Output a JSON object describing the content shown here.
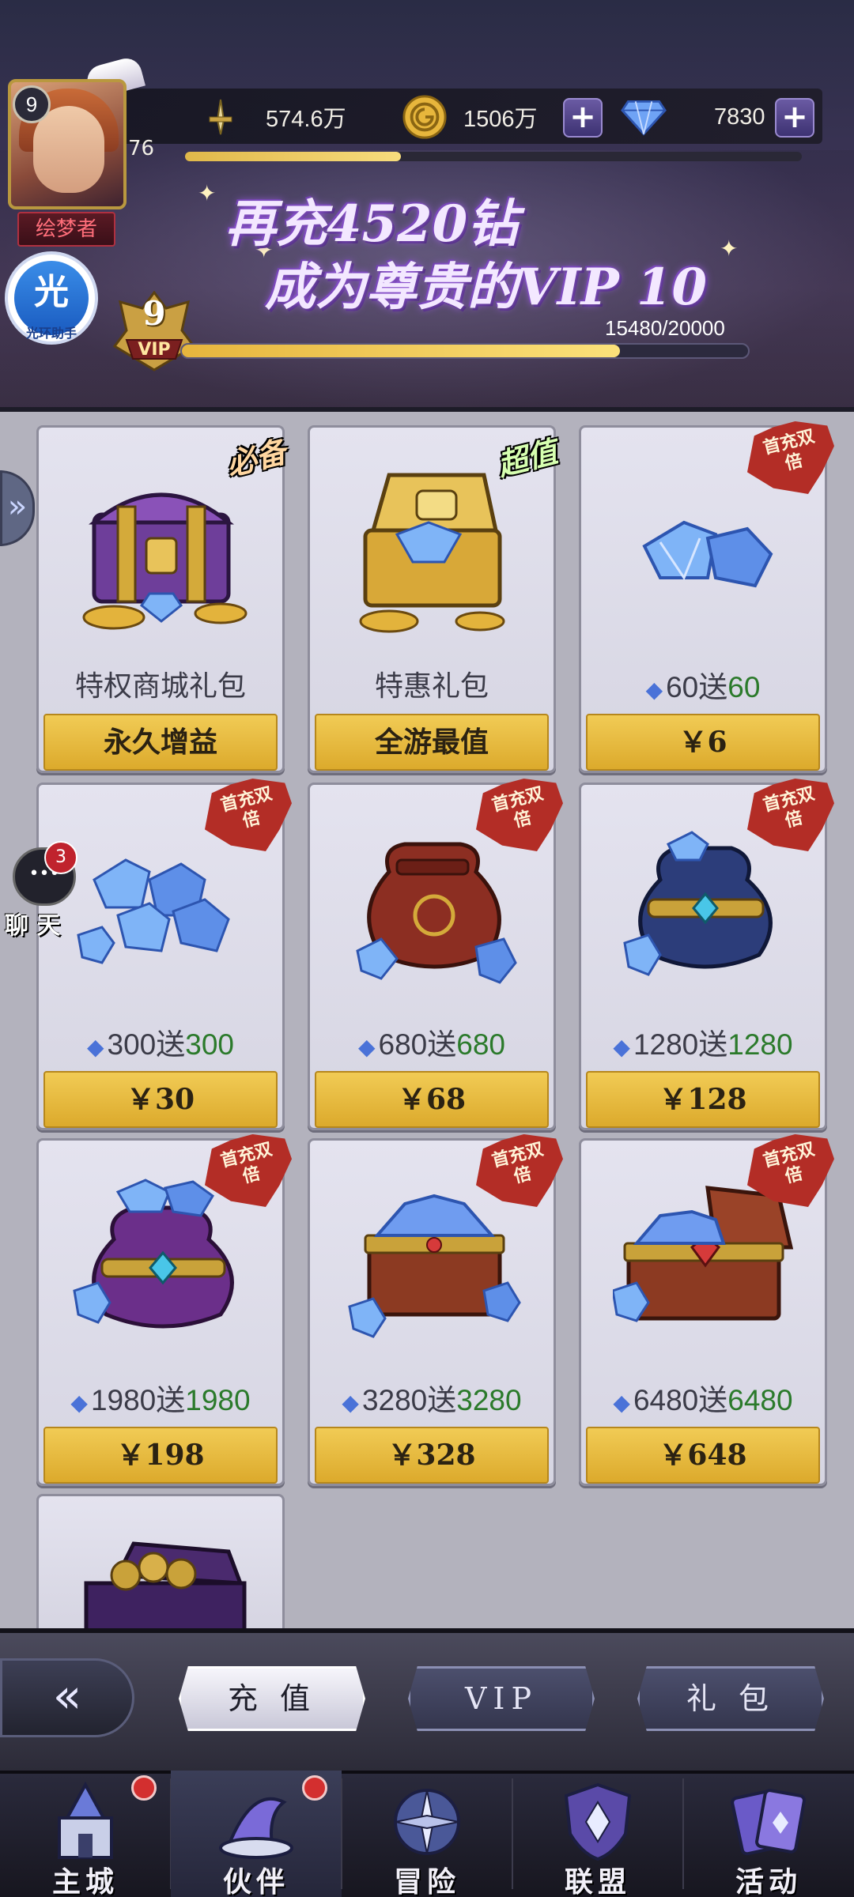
{
  "player": {
    "level": "9",
    "exp": "76",
    "exp_percent": 0.35,
    "title": "绘梦者",
    "assistant_icon": "光",
    "assistant_label": "光环助手"
  },
  "resources": {
    "power": "574.6万",
    "gold": "1506万",
    "gems": "7830"
  },
  "vip": {
    "promo_line1": "再充4520钻",
    "promo_line2": "成为尊贵的VIP 10",
    "level": "9",
    "label": "VIP",
    "progress_text": "15480/20000",
    "progress_current": 15480,
    "progress_max": 20000
  },
  "products": [
    {
      "name": "特权商城礼包",
      "button": "永久增益",
      "tag": "必备"
    },
    {
      "name": "特惠礼包",
      "button": "全游最值",
      "tag": "超值"
    },
    {
      "base": "60送",
      "bonus": "60",
      "price": "￥6",
      "ribbon": "首充双倍"
    },
    {
      "base": "300送",
      "bonus": "300",
      "price": "￥30",
      "ribbon": "首充双倍"
    },
    {
      "base": "680送",
      "bonus": "680",
      "price": "￥68",
      "ribbon": "首充双倍"
    },
    {
      "base": "1280送",
      "bonus": "1280",
      "price": "￥128",
      "ribbon": "首充双倍"
    },
    {
      "base": "1980送",
      "bonus": "1980",
      "price": "￥198",
      "ribbon": "首充双倍"
    },
    {
      "base": "3280送",
      "bonus": "3280",
      "price": "￥328",
      "ribbon": "首充双倍"
    },
    {
      "base": "6480送",
      "bonus": "6480",
      "price": "￥648",
      "ribbon": "首充双倍"
    }
  ],
  "chat": {
    "label": "聊 天",
    "badge": "3"
  },
  "shop_tabs": {
    "recharge": "充 值",
    "vip": "VIP",
    "gift": "礼 包"
  },
  "nav": [
    {
      "label": "主城",
      "icon": "castle-icon"
    },
    {
      "label": "伙伴",
      "icon": "wizard-hat-icon"
    },
    {
      "label": "冒险",
      "icon": "compass-icon"
    },
    {
      "label": "联盟",
      "icon": "shield-icon"
    },
    {
      "label": "活动",
      "icon": "cards-icon"
    }
  ],
  "colors": {
    "price_button": "#dcaa2c",
    "bonus_text": "#2b7a2b",
    "ribbon": "#b32d26",
    "vip_bar": "#fbe17a"
  }
}
